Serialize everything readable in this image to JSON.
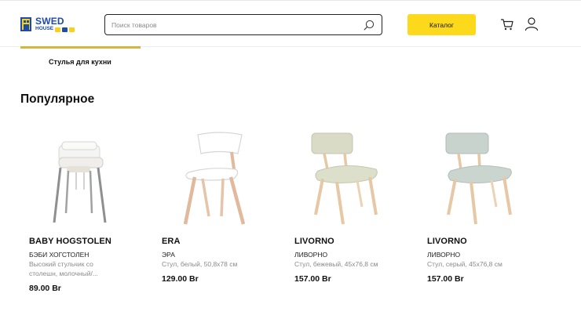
{
  "header": {
    "logo": {
      "line1": "SWED",
      "line2": "HOUSE"
    },
    "search": {
      "placeholder": "Поиск товаров",
      "value": ""
    },
    "catalog_label": "Каталог"
  },
  "subnav": {
    "active_tab": "Стулья для кухни"
  },
  "section": {
    "title": "Популярное"
  },
  "products": [
    {
      "name": "BABY HOGSTOLEN",
      "subtitle": "БЭБИ ХОГСТОЛЕН",
      "desc": "Высокий стульчик со столешн, молочный/...",
      "price": "89.00 Br"
    },
    {
      "name": "ERA",
      "subtitle": "ЭРА",
      "desc": "Стул, белый, 50,8x78 см",
      "price": "129.00 Br"
    },
    {
      "name": "LIVORNO",
      "subtitle": "ЛИВОРНО",
      "desc": "Стул, бежевый, 45x76,8 см",
      "price": "157.00 Br"
    },
    {
      "name": "LIVORNO",
      "subtitle": "ЛИВОРНО",
      "desc": "Стул, серый, 45x76,8 см",
      "price": "157.00 Br"
    }
  ],
  "colors": {
    "accent": "#fcd91b",
    "brand_blue": "#1e4aa8",
    "tab_underline": "#d6b43f"
  }
}
